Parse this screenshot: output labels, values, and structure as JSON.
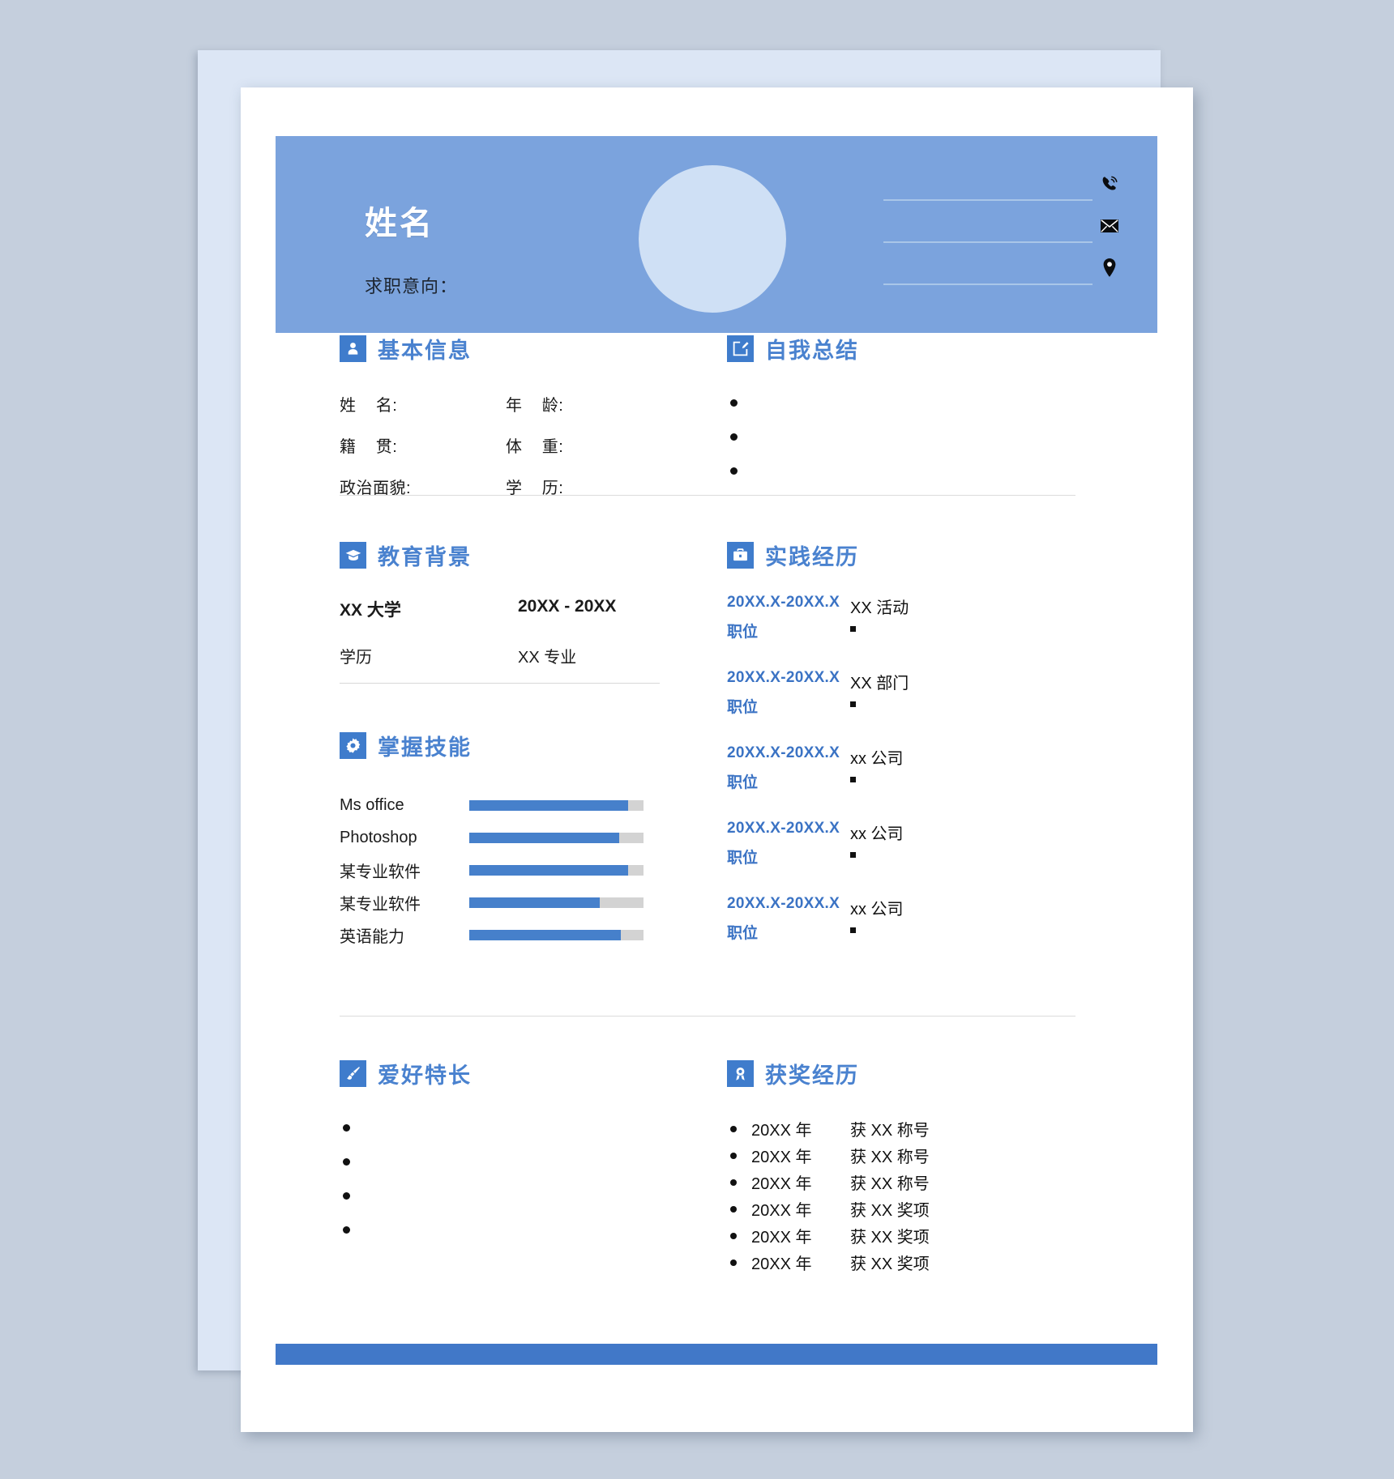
{
  "theme": {
    "backdrop": "#c5cfdd",
    "back_page": "#dce6f5",
    "page": "#ffffff",
    "header_blue": "#7ba3dd",
    "accent_blue": "#4a82cf",
    "icon_blue": "#3f7ccc",
    "bar_fill": "#4680cb",
    "bar_track": "#d3d3d3",
    "footer_blue": "#4178c8",
    "avatar": "#cfe0f5"
  },
  "header": {
    "name": "姓名",
    "objective_label": "求职意向：",
    "avatar_name": "avatar-placeholder",
    "contacts": [
      {
        "icon": "phone-icon",
        "value": ""
      },
      {
        "icon": "email-icon",
        "value": ""
      },
      {
        "icon": "location-icon",
        "value": ""
      }
    ]
  },
  "sections": {
    "basic_info": {
      "title": "基本信息",
      "icon": "person-icon",
      "fields": [
        {
          "label": "姓    名:",
          "value": ""
        },
        {
          "label": "年    龄:",
          "value": ""
        },
        {
          "label": "籍    贯:",
          "value": ""
        },
        {
          "label": "体    重:",
          "value": ""
        },
        {
          "label": "政治面貌:",
          "value": ""
        },
        {
          "label": "学    历:",
          "value": ""
        }
      ]
    },
    "self_summary": {
      "title": "自我总结",
      "icon": "edit-square-icon",
      "bullets": [
        "",
        "",
        ""
      ]
    },
    "education": {
      "title": "教育背景",
      "icon": "graduation-cap-icon",
      "rows": [
        {
          "left": "XX 大学",
          "right": "20XX - 20XX",
          "bold": true
        },
        {
          "left": "学历",
          "right": "XX 专业",
          "bold": false
        }
      ]
    },
    "skills": {
      "title": "掌握技能",
      "icon": "gear-icon",
      "items": [
        {
          "name": "Ms office",
          "level": 91
        },
        {
          "name": "Photoshop",
          "level": 86
        },
        {
          "name": "某专业软件",
          "level": 91
        },
        {
          "name": "某专业软件",
          "level": 75
        },
        {
          "name": "英语能力",
          "level": 87
        }
      ]
    },
    "experience": {
      "title": "实践经历",
      "icon": "briefcase-icon",
      "items": [
        {
          "date": "20XX.X-20XX.X",
          "role": "职位",
          "org": "XX 活动"
        },
        {
          "date": "20XX.X-20XX.X",
          "role": "职位",
          "org": "XX 部门"
        },
        {
          "date": "20XX.X-20XX.X",
          "role": "职位",
          "org": "xx 公司"
        },
        {
          "date": "20XX.X-20XX.X",
          "role": "职位",
          "org": "xx 公司"
        },
        {
          "date": "20XX.X-20XX.X",
          "role": "职位",
          "org": "xx 公司"
        }
      ]
    },
    "hobbies": {
      "title": "爱好特长",
      "icon": "paintbrush-icon",
      "bullets": [
        "",
        "",
        "",
        ""
      ]
    },
    "awards": {
      "title": "获奖经历",
      "icon": "award-medal-icon",
      "items": [
        {
          "year": "20XX 年",
          "text": "获 XX 称号"
        },
        {
          "year": "20XX 年",
          "text": "获 XX 称号"
        },
        {
          "year": "20XX 年",
          "text": "获 XX 称号"
        },
        {
          "year": "20XX 年",
          "text": "获 XX 奖项"
        },
        {
          "year": "20XX 年",
          "text": "获 XX 奖项"
        },
        {
          "year": "20XX 年",
          "text": "获 XX 奖项"
        }
      ]
    }
  }
}
